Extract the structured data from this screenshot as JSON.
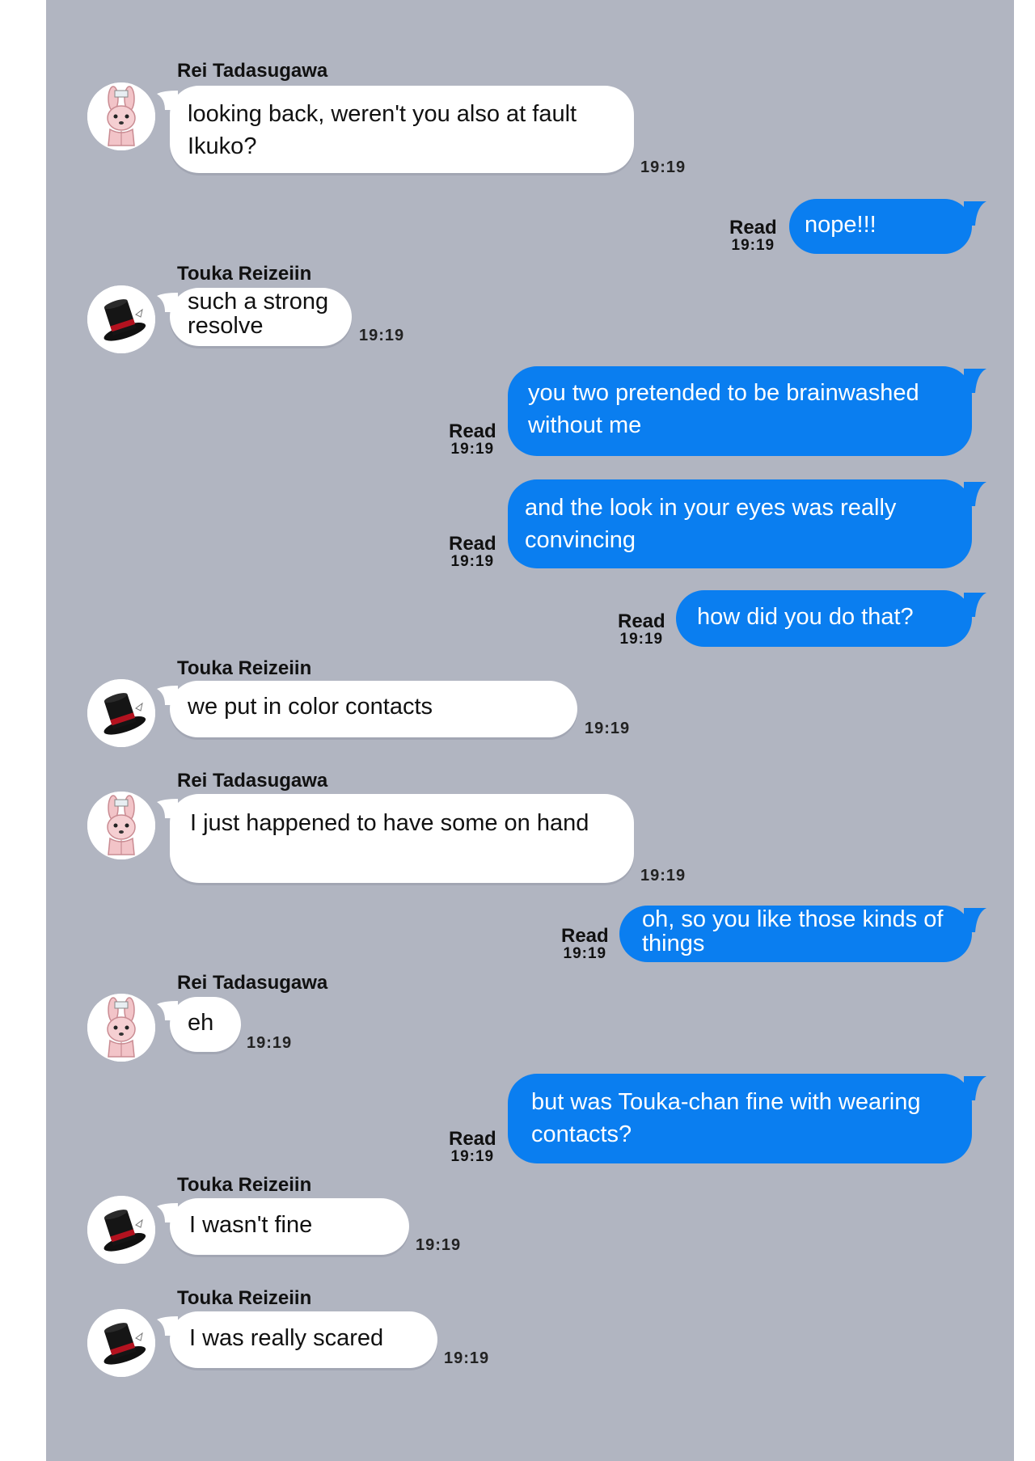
{
  "colors": {
    "background": "#b1b5c1",
    "incoming_bubble": "#ffffff",
    "outgoing_bubble": "#0a7ef0"
  },
  "contacts": {
    "rei": {
      "name": "Rei Tadasugawa",
      "avatar_icon": "pink-bunny-icon"
    },
    "touka": {
      "name": "Touka Reizeiin",
      "avatar_icon": "black-top-hat-icon"
    }
  },
  "read_label": "Read",
  "messages": [
    {
      "direction": "in",
      "sender": "Rei Tadasugawa",
      "text": "looking back, weren't you also at fault Ikuko?",
      "time": "19:19"
    },
    {
      "direction": "out",
      "text": "nope!!!",
      "read": "Read",
      "time": "19:19"
    },
    {
      "direction": "in",
      "sender": "Touka Reizeiin",
      "text": "such a strong resolve",
      "time": "19:19"
    },
    {
      "direction": "out",
      "text": "you two pretended to be brainwashed without me",
      "read": "Read",
      "time": "19:19"
    },
    {
      "direction": "out",
      "text": "and the look in your eyes was really convincing",
      "read": "Read",
      "time": "19:19"
    },
    {
      "direction": "out",
      "text": "how did you do that?",
      "read": "Read",
      "time": "19:19"
    },
    {
      "direction": "in",
      "sender": "Touka Reizeiin",
      "text": "we put in color contacts",
      "time": "19:19"
    },
    {
      "direction": "in",
      "sender": "Rei Tadasugawa",
      "text": "I just happened to have some on hand",
      "time": "19:19"
    },
    {
      "direction": "out",
      "text": "oh, so you like those kinds of things",
      "read": "Read",
      "time": "19:19"
    },
    {
      "direction": "in",
      "sender": "Rei Tadasugawa",
      "text": "eh",
      "time": "19:19"
    },
    {
      "direction": "out",
      "text": "but was Touka-chan fine with wearing contacts?",
      "read": "Read",
      "time": "19:19"
    },
    {
      "direction": "in",
      "sender": "Touka Reizeiin",
      "text": "I wasn't fine",
      "time": "19:19"
    },
    {
      "direction": "in",
      "sender": "Touka Reizeiin",
      "text": "I was really scared",
      "time": "19:19"
    }
  ]
}
